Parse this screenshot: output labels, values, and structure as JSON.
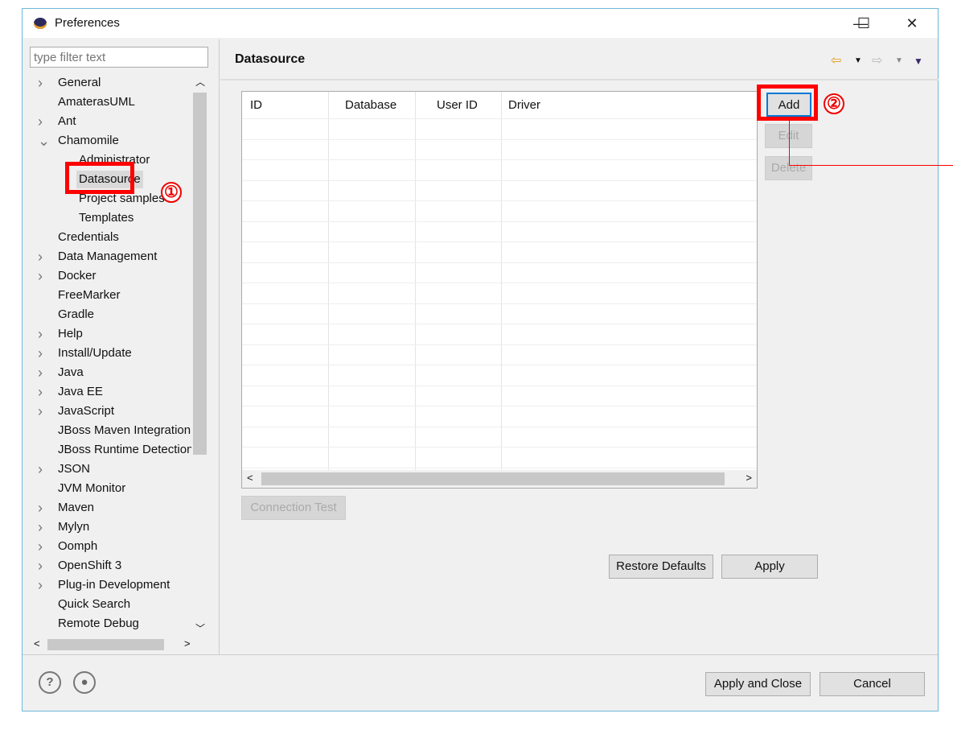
{
  "window": {
    "title": "Preferences",
    "minimize": "—",
    "maximize": "☐",
    "close": "✕"
  },
  "filter": {
    "placeholder": "type filter text"
  },
  "tree": [
    {
      "label": "General",
      "arrow": ">",
      "indent": 0
    },
    {
      "label": "AmaterasUML",
      "arrow": "",
      "indent": 0
    },
    {
      "label": "Ant",
      "arrow": ">",
      "indent": 0
    },
    {
      "label": "Chamomile",
      "arrow": "v",
      "indent": 0
    },
    {
      "label": "Administrator",
      "arrow": "",
      "indent": 1
    },
    {
      "label": "Datasource",
      "arrow": "",
      "indent": 1,
      "selected": true
    },
    {
      "label": "Project samples",
      "arrow": "",
      "indent": 1
    },
    {
      "label": "Templates",
      "arrow": "",
      "indent": 1
    },
    {
      "label": "Credentials",
      "arrow": "",
      "indent": 0
    },
    {
      "label": "Data Management",
      "arrow": ">",
      "indent": 0
    },
    {
      "label": "Docker",
      "arrow": ">",
      "indent": 0
    },
    {
      "label": "FreeMarker",
      "arrow": "",
      "indent": 0
    },
    {
      "label": "Gradle",
      "arrow": "",
      "indent": 0
    },
    {
      "label": "Help",
      "arrow": ">",
      "indent": 0
    },
    {
      "label": "Install/Update",
      "arrow": ">",
      "indent": 0
    },
    {
      "label": "Java",
      "arrow": ">",
      "indent": 0
    },
    {
      "label": "Java EE",
      "arrow": ">",
      "indent": 0
    },
    {
      "label": "JavaScript",
      "arrow": ">",
      "indent": 0
    },
    {
      "label": "JBoss Maven Integration",
      "arrow": "",
      "indent": 0
    },
    {
      "label": "JBoss Runtime Detection",
      "arrow": "",
      "indent": 0
    },
    {
      "label": "JSON",
      "arrow": ">",
      "indent": 0
    },
    {
      "label": "JVM Monitor",
      "arrow": "",
      "indent": 0
    },
    {
      "label": "Maven",
      "arrow": ">",
      "indent": 0
    },
    {
      "label": "Mylyn",
      "arrow": ">",
      "indent": 0
    },
    {
      "label": "Oomph",
      "arrow": ">",
      "indent": 0
    },
    {
      "label": "OpenShift 3",
      "arrow": ">",
      "indent": 0
    },
    {
      "label": "Plug-in Development",
      "arrow": ">",
      "indent": 0
    },
    {
      "label": "Quick Search",
      "arrow": "",
      "indent": 0
    },
    {
      "label": "Remote Debug",
      "arrow": "",
      "indent": 0
    }
  ],
  "page": {
    "title": "Datasource"
  },
  "table": {
    "columns": [
      "ID",
      "Database",
      "User ID",
      "Driver"
    ],
    "rows": []
  },
  "buttons": {
    "add": "Add",
    "edit": "Edit",
    "delete": "Delete",
    "connection_test": "Connection Test",
    "restore_defaults": "Restore Defaults",
    "apply": "Apply",
    "apply_close": "Apply and Close",
    "cancel": "Cancel"
  },
  "annotations": {
    "one": "①",
    "two": "②"
  },
  "colors": {
    "highlight": "#ff0000",
    "focus": "#0078d7"
  }
}
